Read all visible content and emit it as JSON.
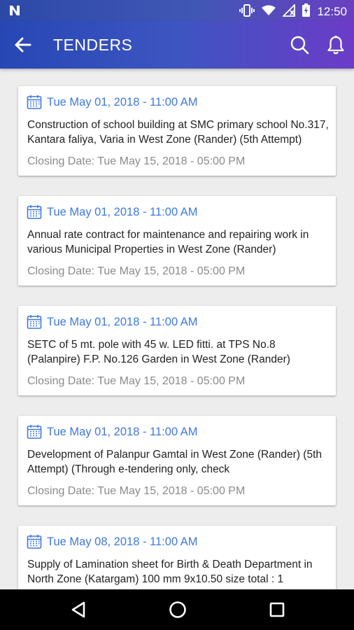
{
  "status_bar": {
    "time": "12:50",
    "icons": [
      "app-n-icon",
      "vibrate-icon",
      "wifi-icon",
      "no-signal-icon",
      "battery-charging-icon"
    ]
  },
  "app_bar": {
    "title": "TENDERS",
    "icons": [
      "back-arrow-icon",
      "search-icon",
      "bell-icon"
    ]
  },
  "tenders": [
    {
      "date": "Tue May 01, 2018 - 11:00 AM",
      "description": "Construction of school building at SMC primary school No.317, Kantara faliya, Varia in West Zone (Rander) (5th Attempt)",
      "closing": "Closing Date: Tue May 15, 2018 - 05:00 PM"
    },
    {
      "date": "Tue May 01, 2018 - 11:00 AM",
      "description": "Annual rate contract for maintenance  and repairing work in various Municipal Properties in West Zone (Rander)",
      "closing": "Closing Date: Tue May 15, 2018 - 05:00 PM"
    },
    {
      "date": "Tue May 01, 2018 - 11:00 AM",
      "description": "SETC of 5 mt. pole with 45 w. LED fitti. at TPS No.8 (Palanpire) F.P. No.126 Garden in West Zone (Rander)",
      "closing": "Closing Date: Tue May 15, 2018 - 05:00 PM"
    },
    {
      "date": "Tue May 01, 2018 - 11:00 AM",
      "description": "Development of Palanpur Gamtal in West Zone (Rander) (5th Attempt) (Through e-tendering only, check",
      "closing": "Closing Date: Tue May 15, 2018 - 05:00 PM"
    },
    {
      "date": "Tue May 08, 2018 - 11:00 AM",
      "description": "Supply of Lamination sheet for Birth & Death Department in North Zone (Katargam) 100 mm 9x10.50 size total : 1",
      "closing": ""
    }
  ],
  "colors": {
    "accent": "#3f78e0",
    "app_bar_start": "#2747b5",
    "app_bar_end": "#6c3cc8"
  }
}
